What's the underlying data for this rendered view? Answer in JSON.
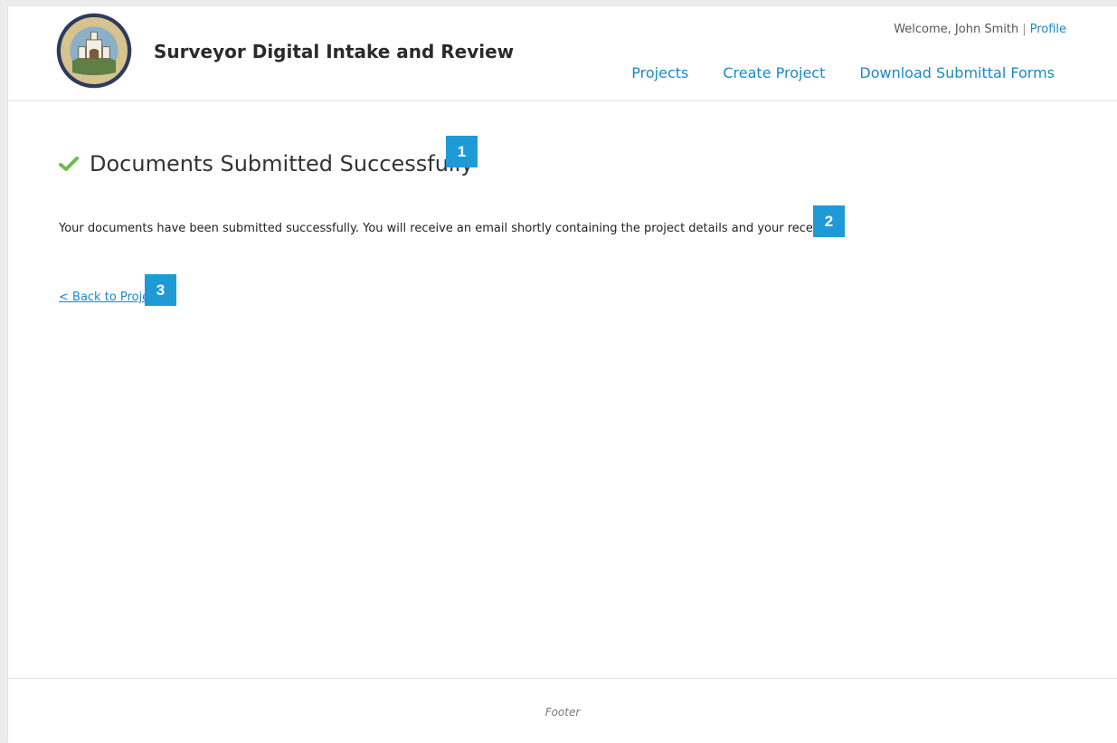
{
  "header": {
    "title": "Surveyor Digital Intake and Review",
    "seal_text": "COUNTY OF SANTA BARBARA CALIFORNIA",
    "welcome_text": "Welcome, John Smith",
    "separator": "|",
    "profile_link": "Profile",
    "nav": [
      "Projects",
      "Create Project",
      "Download Submittal Forms"
    ]
  },
  "main": {
    "heading": "Documents Submitted Successfully",
    "message": "Your documents have been submitted successfully. You will receive an email shortly containing the project details and your recei",
    "back_link": "< Back to Proje"
  },
  "markers": [
    "1",
    "2",
    "3"
  ],
  "footer": {
    "text": "Footer"
  },
  "colors": {
    "link": "#1a88c9",
    "success_check": "#6abf4b",
    "marker": "#1e9bd7"
  },
  "icons": {
    "check": "check-icon"
  }
}
